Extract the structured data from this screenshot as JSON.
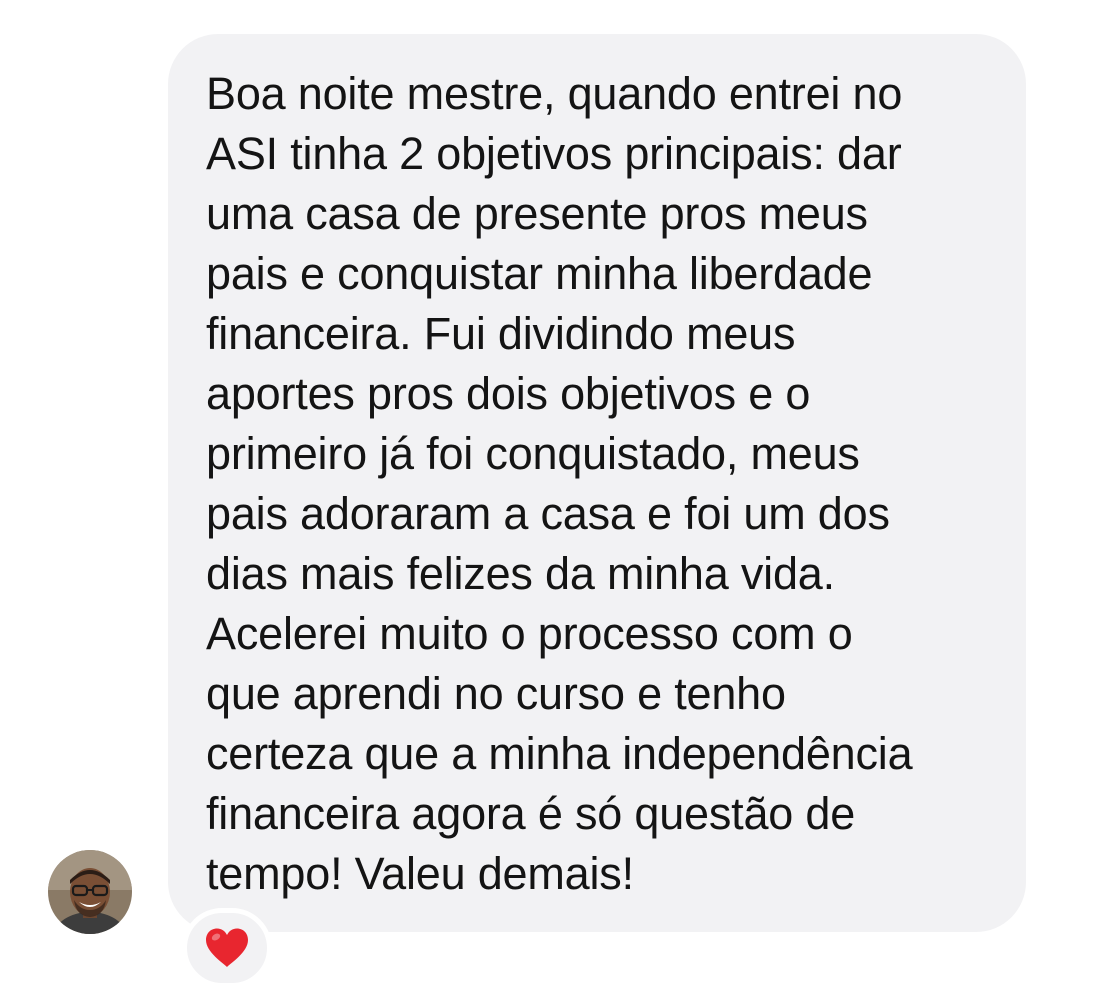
{
  "message": {
    "lines": [
      "Boa noite mestre, quando entrei no",
      "ASI tinha 2 objetivos principais: dar",
      "uma casa de presente pros meus",
      "pais e conquistar minha liberdade",
      "financeira. Fui dividindo meus",
      "aportes pros dois objetivos e o",
      "primeiro já foi conquistado, meus",
      "pais adoraram a casa e foi um dos",
      "dias mais felizes da minha vida.",
      "Acelerei muito o processo com o",
      "que aprendi no curso e tenho",
      "certeza que a minha independência",
      "financeira agora é só questão de",
      "tempo! Valeu demais!"
    ]
  },
  "reaction": {
    "icon": "heart-icon",
    "color": "#e8262f"
  },
  "sender": {
    "avatar_icon": "avatar"
  },
  "colors": {
    "bubble_background": "#f2f2f4",
    "text": "#141414",
    "page_background": "#ffffff"
  }
}
